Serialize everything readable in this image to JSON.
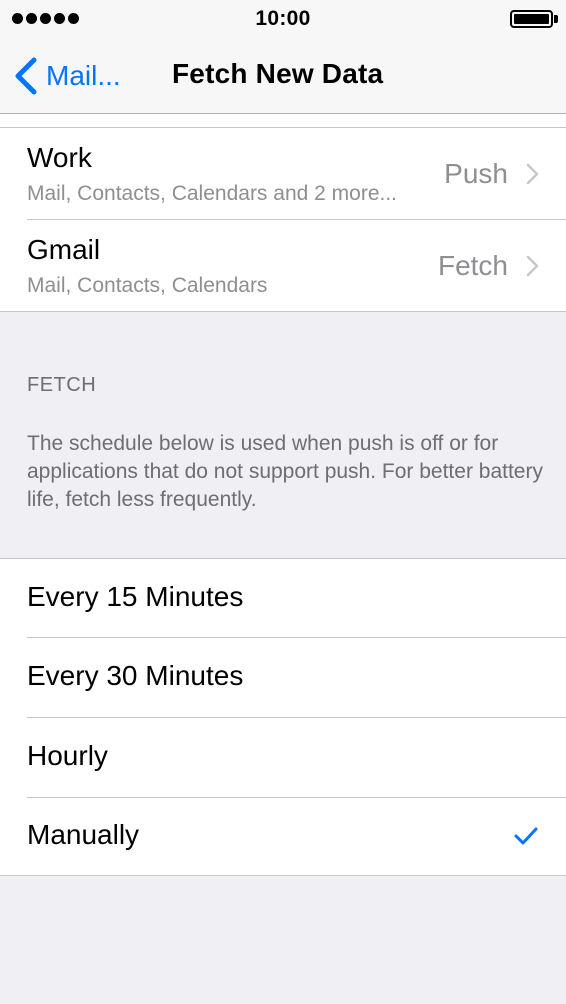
{
  "status_bar": {
    "time": "10:00"
  },
  "nav": {
    "back_label": "Mail...",
    "title": "Fetch New Data"
  },
  "accounts": [
    {
      "name": "Work",
      "detail": "Mail, Contacts, Calendars and 2 more...",
      "value": "Push"
    },
    {
      "name": "Gmail",
      "detail": "Mail, Contacts, Calendars",
      "value": "Fetch"
    }
  ],
  "fetch_section": {
    "header": "FETCH",
    "footer": "The schedule below is used when push is off or for applications that do not support push. For better battery life, fetch less frequently."
  },
  "fetch_options": [
    {
      "label": "Every 15 Minutes",
      "selected": false
    },
    {
      "label": "Every 30 Minutes",
      "selected": false
    },
    {
      "label": "Hourly",
      "selected": false
    },
    {
      "label": "Manually",
      "selected": true
    }
  ],
  "colors": {
    "accent": "#0076ff",
    "secondary_text": "#8e8e93",
    "group_background": "#efeff4"
  }
}
